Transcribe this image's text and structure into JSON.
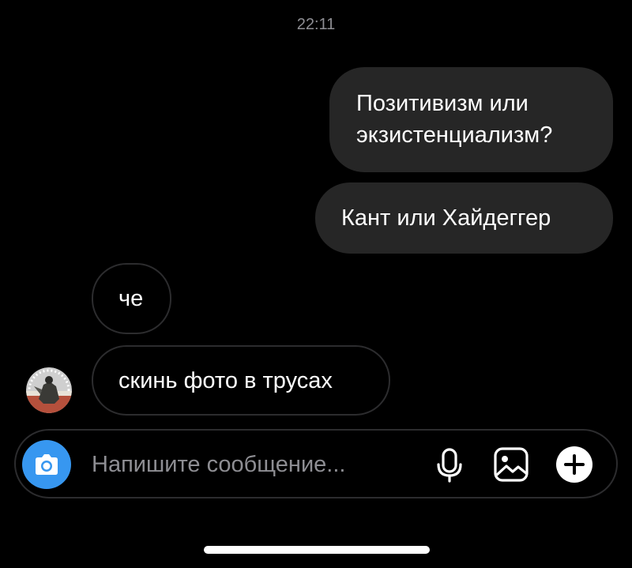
{
  "chat": {
    "timestamp": "22:11",
    "messages": [
      {
        "direction": "outgoing",
        "lines": [
          "Позитивизм или",
          "экзистенциализм?"
        ]
      },
      {
        "direction": "outgoing",
        "text": "Кант или Хайдеггер"
      },
      {
        "direction": "incoming",
        "text": "че"
      },
      {
        "direction": "incoming",
        "text": "скинь фото в трусах"
      }
    ]
  },
  "composer": {
    "placeholder": "Напишите сообщение...",
    "camera_icon": "camera-icon",
    "mic_icon": "microphone-icon",
    "gallery_icon": "image-icon",
    "plus_icon": "plus-icon"
  },
  "colors": {
    "background": "#000000",
    "outgoing_bubble": "#262626",
    "incoming_border": "#2c2c2e",
    "accent": "#3797f0",
    "muted_text": "#8e8e93"
  }
}
